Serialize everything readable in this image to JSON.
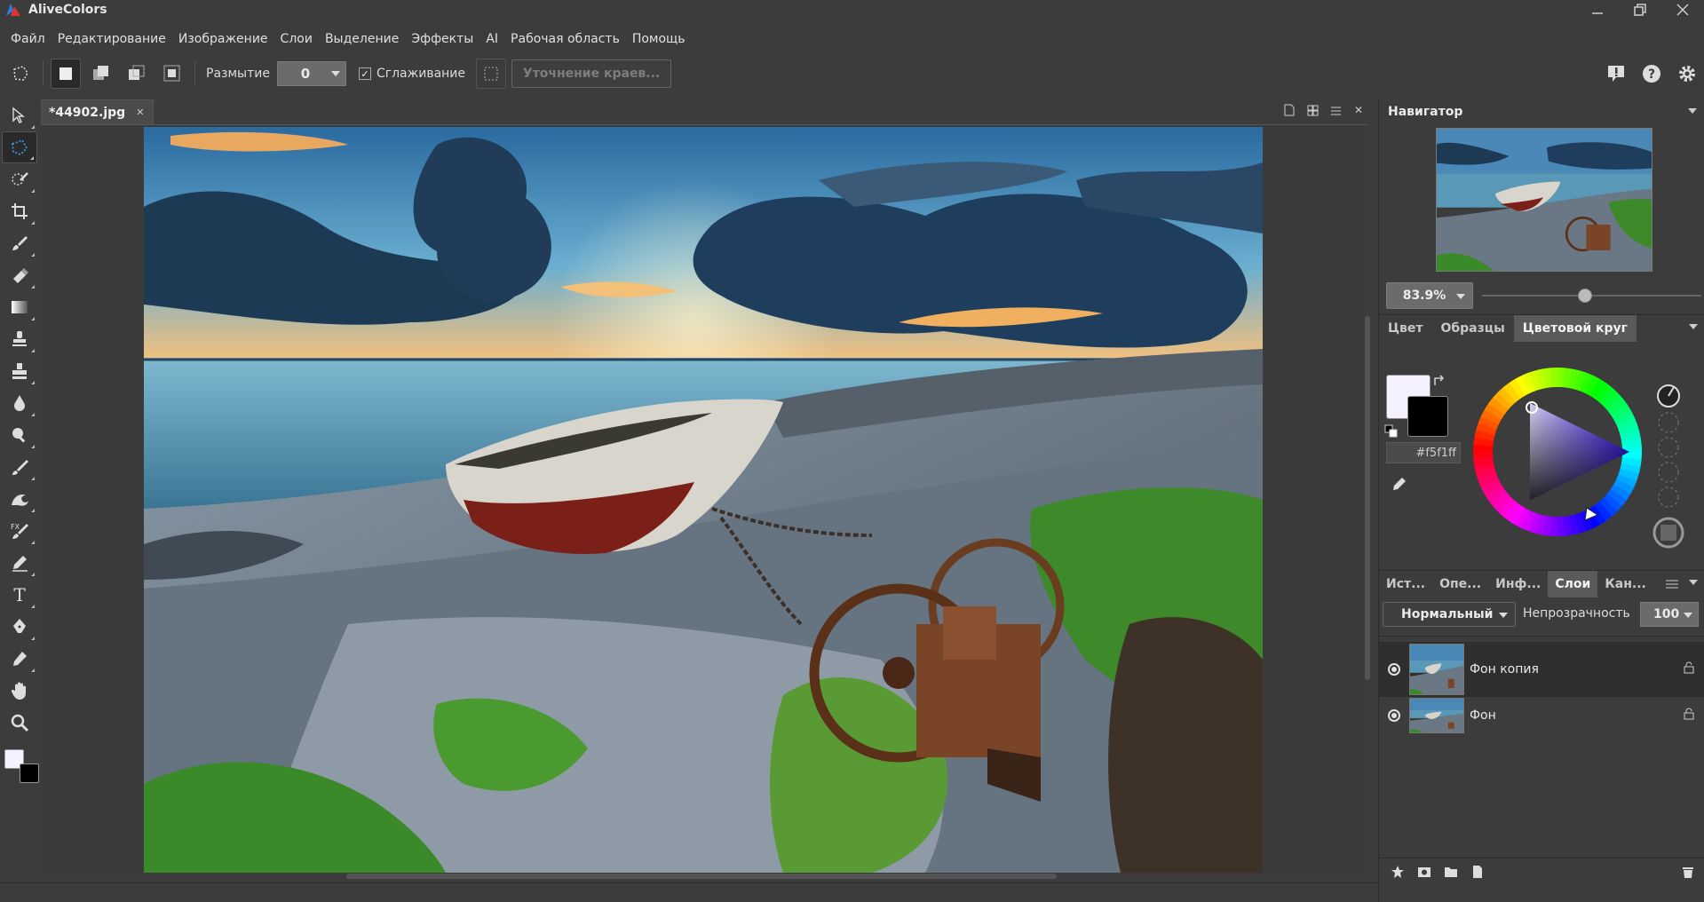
{
  "app": {
    "title": "AliveColors"
  },
  "menu": [
    "Файл",
    "Редактирование",
    "Изображение",
    "Слои",
    "Выделение",
    "Эффекты",
    "AI",
    "Рабочая область",
    "Помощь"
  ],
  "options": {
    "blur_label": "Размытие",
    "blur_value": "0",
    "smoothing_label": "Сглаживание",
    "smoothing_checked": true,
    "refine_label": "Уточнение краев..."
  },
  "document": {
    "tab_name": "*44902.jpg"
  },
  "navigator": {
    "title": "Навигатор",
    "zoom": "83.9%",
    "zoom_level_fraction": 0.47
  },
  "color_panel": {
    "tabs": [
      "Цвет",
      "Образцы",
      "Цветовой круг"
    ],
    "active_tab": "Цветовой круг",
    "foreground_hex": "#f5f1ff",
    "hex_display": "#f5f1ff",
    "background_color": "#000000"
  },
  "layers_panel": {
    "tabs": [
      "Ист...",
      "Опе...",
      "Инф...",
      "Слои",
      "Кан..."
    ],
    "active_tab": "Слои",
    "blend_mode": "Нормальный",
    "opacity_label": "Непрозрачность",
    "opacity_value": "100",
    "layers": [
      {
        "name": "Фон копия",
        "selected": true
      },
      {
        "name": "Фон",
        "selected": false
      }
    ]
  },
  "icons": {
    "tools": [
      "move-icon",
      "lasso-select-icon",
      "quick-select-icon",
      "crop-icon",
      "brush-icon",
      "eraser-icon",
      "gradient-icon",
      "stamp-icon",
      "clone-icon",
      "blur-drop-icon",
      "sponge-icon",
      "smudge-icon",
      "wave-icon",
      "fx-brush-icon",
      "pencil-icon",
      "text-icon",
      "pen-icon",
      "eyedropper-icon",
      "hand-icon",
      "zoom-icon"
    ]
  },
  "colors": {
    "bg": "#3c3c3c",
    "panel_active": "#5a5a5a",
    "selected_layer": "#2f2f2f"
  }
}
